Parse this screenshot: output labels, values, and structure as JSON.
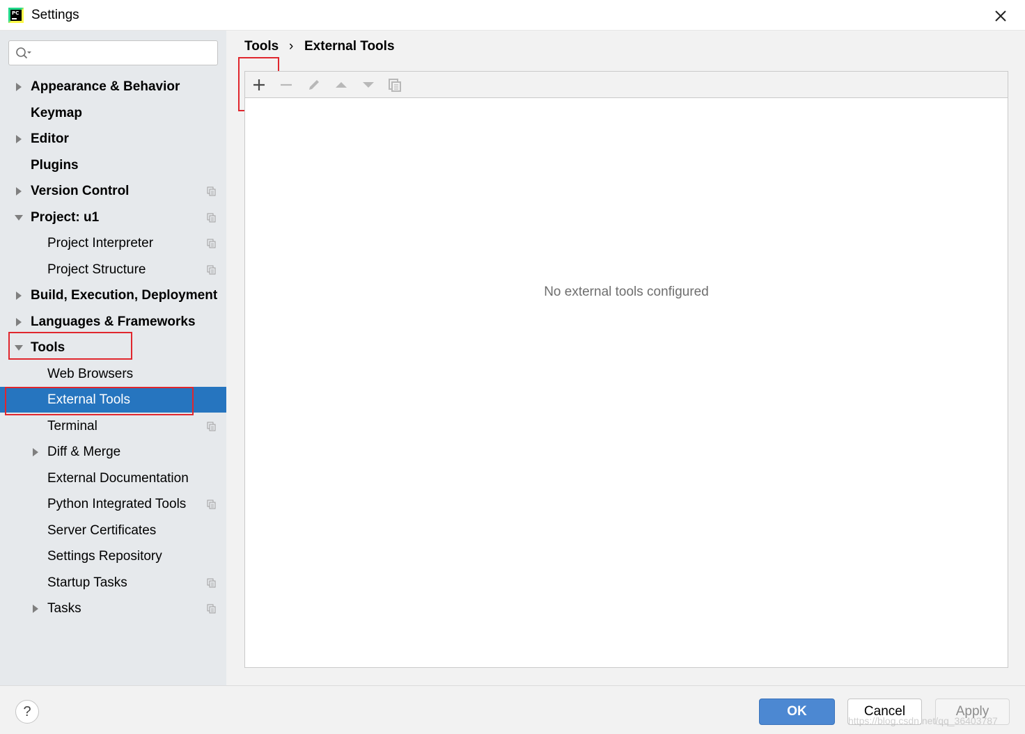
{
  "window": {
    "title": "Settings",
    "close_icon": "close-icon",
    "logo_text": "PC"
  },
  "search": {
    "placeholder": "",
    "icon": "search-icon"
  },
  "sidebar": {
    "items": [
      {
        "label": "Appearance & Behavior",
        "bold": true,
        "indent": 0,
        "arrow": "right",
        "project_icon": false,
        "selected": false
      },
      {
        "label": "Keymap",
        "bold": true,
        "indent": 0,
        "arrow": "none",
        "project_icon": false,
        "selected": false
      },
      {
        "label": "Editor",
        "bold": true,
        "indent": 0,
        "arrow": "right",
        "project_icon": false,
        "selected": false
      },
      {
        "label": "Plugins",
        "bold": true,
        "indent": 0,
        "arrow": "none",
        "project_icon": false,
        "selected": false
      },
      {
        "label": "Version Control",
        "bold": true,
        "indent": 0,
        "arrow": "right",
        "project_icon": true,
        "selected": false
      },
      {
        "label": "Project: u1",
        "bold": true,
        "indent": 0,
        "arrow": "down",
        "project_icon": true,
        "selected": false
      },
      {
        "label": "Project Interpreter",
        "bold": false,
        "indent": 1,
        "arrow": "none",
        "project_icon": true,
        "selected": false
      },
      {
        "label": "Project Structure",
        "bold": false,
        "indent": 1,
        "arrow": "none",
        "project_icon": true,
        "selected": false
      },
      {
        "label": "Build, Execution, Deployment",
        "bold": true,
        "indent": 0,
        "arrow": "right",
        "project_icon": false,
        "selected": false
      },
      {
        "label": "Languages & Frameworks",
        "bold": true,
        "indent": 0,
        "arrow": "right",
        "project_icon": false,
        "selected": false
      },
      {
        "label": "Tools",
        "bold": true,
        "indent": 0,
        "arrow": "down",
        "project_icon": false,
        "selected": false
      },
      {
        "label": "Web Browsers",
        "bold": false,
        "indent": 1,
        "arrow": "none",
        "project_icon": false,
        "selected": false
      },
      {
        "label": "External Tools",
        "bold": false,
        "indent": 1,
        "arrow": "none",
        "project_icon": false,
        "selected": true
      },
      {
        "label": "Terminal",
        "bold": false,
        "indent": 1,
        "arrow": "none",
        "project_icon": true,
        "selected": false
      },
      {
        "label": "Diff & Merge",
        "bold": false,
        "indent": 1,
        "arrow": "right",
        "project_icon": false,
        "selected": false
      },
      {
        "label": "External Documentation",
        "bold": false,
        "indent": 1,
        "arrow": "none",
        "project_icon": false,
        "selected": false
      },
      {
        "label": "Python Integrated Tools",
        "bold": false,
        "indent": 1,
        "arrow": "none",
        "project_icon": true,
        "selected": false
      },
      {
        "label": "Server Certificates",
        "bold": false,
        "indent": 1,
        "arrow": "none",
        "project_icon": false,
        "selected": false
      },
      {
        "label": "Settings Repository",
        "bold": false,
        "indent": 1,
        "arrow": "none",
        "project_icon": false,
        "selected": false
      },
      {
        "label": "Startup Tasks",
        "bold": false,
        "indent": 1,
        "arrow": "none",
        "project_icon": true,
        "selected": false
      },
      {
        "label": "Tasks",
        "bold": false,
        "indent": 1,
        "arrow": "right",
        "project_icon": true,
        "selected": false
      }
    ]
  },
  "breadcrumb": {
    "parent": "Tools",
    "separator": "›",
    "current": "External Tools"
  },
  "toolbar": {
    "buttons": [
      {
        "icon": "plus-icon",
        "enabled": true
      },
      {
        "icon": "minus-icon",
        "enabled": false
      },
      {
        "icon": "pencil-icon",
        "enabled": false
      },
      {
        "icon": "move-up-icon",
        "enabled": false
      },
      {
        "icon": "move-down-icon",
        "enabled": false
      },
      {
        "icon": "copy-icon",
        "enabled": false
      }
    ]
  },
  "panel": {
    "empty_text": "No external tools configured"
  },
  "footer": {
    "help_label": "?",
    "ok_label": "OK",
    "cancel_label": "Cancel",
    "apply_label": "Apply",
    "watermark": "https://blog.csdn.net/qq_36403787"
  },
  "colors": {
    "selection": "#2675bf",
    "highlight_box": "#e0262d",
    "ok_button": "#4c88d2",
    "sidebar_bg": "#e6e9ec"
  }
}
